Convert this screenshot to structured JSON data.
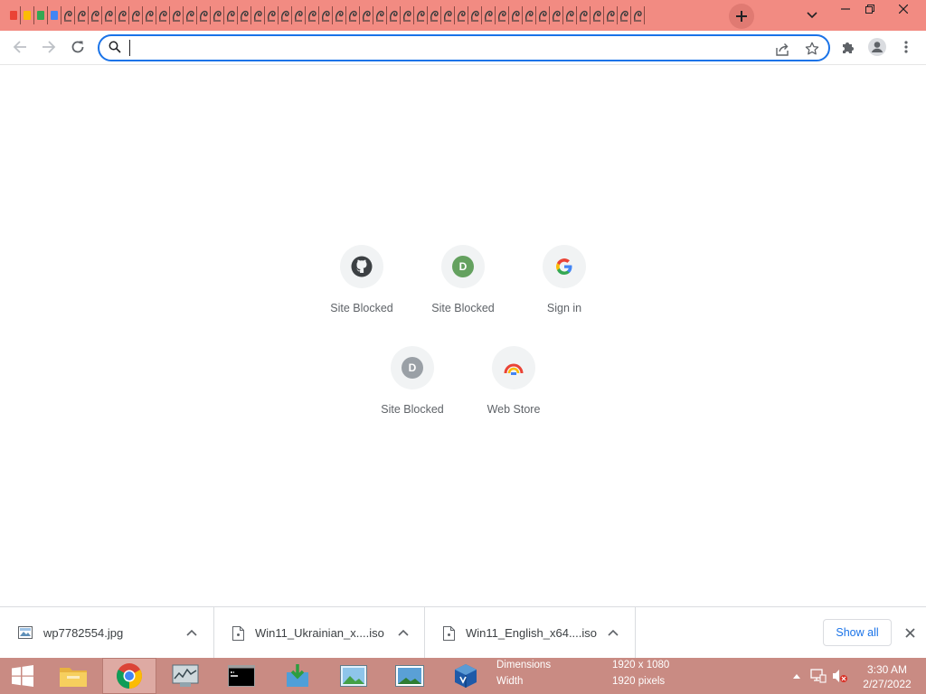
{
  "window": {
    "tab_count": 47,
    "new_tab_icon": "plus-icon",
    "tab_search_icon": "chevron-down-icon",
    "controls": [
      "minimize-icon",
      "restore-icon",
      "close-icon"
    ]
  },
  "toolbar": {
    "back_icon": "arrow-left-icon",
    "forward_icon": "arrow-right-icon",
    "reload_icon": "reload-icon",
    "omnibox": {
      "value": "",
      "placeholder": ""
    },
    "share_icon": "share-icon",
    "bookmark_icon": "star-icon",
    "extensions_icon": "puzzle-icon",
    "profile_icon": "person-icon",
    "menu_icon": "more-vert-icon"
  },
  "shortcuts": [
    {
      "label": "Site Blocked",
      "icon": "github-icon"
    },
    {
      "label": "Site Blocked",
      "icon": "letter-d-icon",
      "letter": "D"
    },
    {
      "label": "Sign in",
      "icon": "google-icon"
    },
    {
      "label": "Site Blocked",
      "icon": "letter-d-icon",
      "letter": "D"
    },
    {
      "label": "Web Store",
      "icon": "webstore-icon"
    }
  ],
  "downloads": {
    "items": [
      {
        "name": "wp7782554.jpg",
        "icon": "image-file-icon"
      },
      {
        "name": "Win11_Ukrainian_x....iso",
        "icon": "file-icon"
      },
      {
        "name": "Win11_English_x64....iso",
        "icon": "file-icon"
      }
    ],
    "show_all": "Show all"
  },
  "taskbar": {
    "apps": [
      "windows-start-icon",
      "file-explorer-icon",
      "chrome-icon",
      "resource-monitor-icon",
      "command-prompt-icon",
      "download-app-icon",
      "photo-viewer-icon",
      "image-app-icon",
      "virtualbox-icon"
    ],
    "tooltip": {
      "row1_label": "Dimensions",
      "row1_value": "1920 x 1080",
      "row2_label": "Width",
      "row2_value": "1920 pixels"
    },
    "clock_time": "3:30 AM",
    "clock_date": "2/27/2022"
  },
  "colors": {
    "tab_strip": "#f28b82",
    "taskbar": "#c98b83",
    "accent": "#1a73e8"
  }
}
